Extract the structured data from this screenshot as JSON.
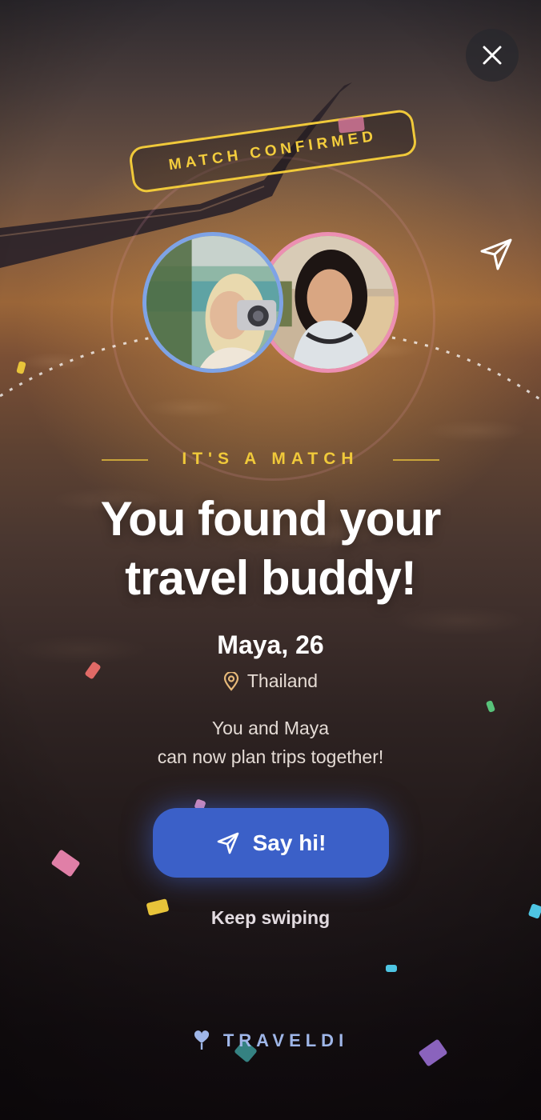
{
  "badge": {
    "text": "MATCH CONFIRMED"
  },
  "eyebrow": "IT'S A MATCH",
  "headline": {
    "line1": "You found your",
    "line2": "travel buddy!"
  },
  "profile": {
    "name_age": "Maya, 26",
    "location": "Thailand"
  },
  "description": {
    "line1": "You and Maya",
    "line2": "can now plan trips together!"
  },
  "actions": {
    "primary": "Say hi!",
    "secondary": "Keep swiping"
  },
  "brand": {
    "name": "TRAVELDI"
  },
  "icons": {
    "close": "close-icon",
    "send_top": "paper-plane-icon",
    "location": "location-pin-icon",
    "cta": "paper-plane-icon",
    "brand": "heart-pin-icon"
  },
  "colors": {
    "accent_gold": "#f0c93a",
    "button_blue": "#3b60c8",
    "left_avatar_ring": "#7ea3e6",
    "right_avatar_ring": "#ec8fb2",
    "brand_text": "#9fb6e8"
  }
}
